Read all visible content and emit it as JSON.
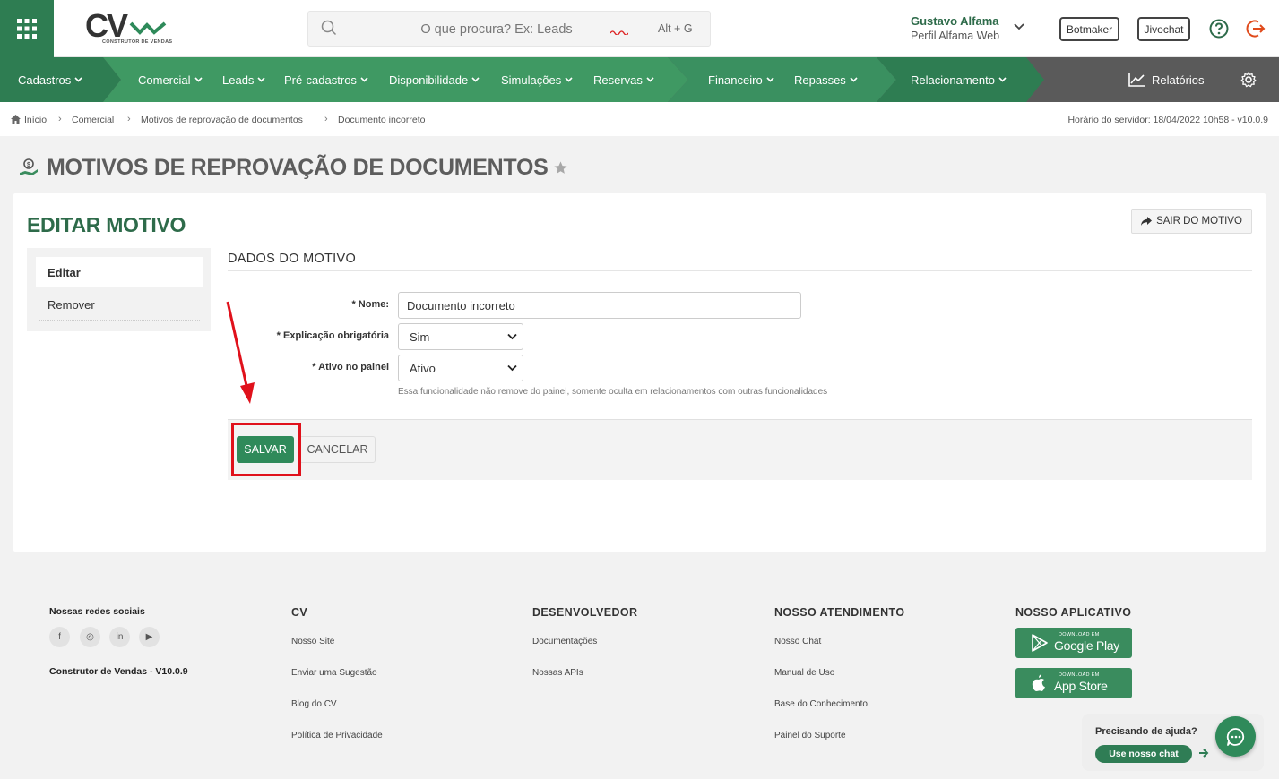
{
  "header": {
    "logo_text": "CV",
    "logo_subtitle": "CONSTRUTOR DE VENDAS",
    "search_placeholder": "O que procura? Ex: Leads",
    "search_shortcut": "Alt + G",
    "user_name": "Gustavo Alfama",
    "user_profile": "Perfil Alfama Web",
    "botmaker_label": "Botmaker",
    "jivochat_label": "Jivochat"
  },
  "nav": {
    "items": [
      {
        "label": "Cadastros"
      },
      {
        "label": "Comercial"
      },
      {
        "label": "Leads"
      },
      {
        "label": "Pré-cadastros"
      },
      {
        "label": "Disponibilidade"
      },
      {
        "label": "Simulações"
      },
      {
        "label": "Reservas"
      },
      {
        "label": "Financeiro"
      },
      {
        "label": "Repasses"
      },
      {
        "label": "Relacionamento"
      }
    ],
    "reports_label": "Relatórios",
    "colors": {
      "dark": "#2e7d52",
      "mid": "#3f9963",
      "light": "#4aa36d",
      "gray": "#5a5a5a"
    }
  },
  "breadcrumb": {
    "items": [
      "Início",
      "Comercial",
      "Motivos de reprovação de documentos",
      "Documento incorreto"
    ],
    "server_time": "Horário do servidor: 18/04/2022 10h58 - v10.0.9"
  },
  "page": {
    "title": "MOTIVOS DE REPROVAÇÃO DE DOCUMENTOS"
  },
  "card": {
    "title": "EDITAR MOTIVO",
    "exit_label": "SAIR DO MOTIVO",
    "side_nav": [
      "Editar",
      "Remover"
    ],
    "section_title": "DADOS DO MOTIVO",
    "fields": {
      "nome_label": "* Nome:",
      "nome_value": "Documento incorreto",
      "explicacao_label": "* Explicação obrigatória",
      "explicacao_value": "Sim",
      "ativo_label": "* Ativo no painel",
      "ativo_value": "Ativo",
      "help_text": "Essa funcionalidade não remove do painel, somente oculta em relacionamentos com outras funcionalidades"
    },
    "save_label": "SALVAR",
    "cancel_label": "CANCELAR"
  },
  "footer": {
    "social_title": "Nossas redes sociais",
    "social_icons": [
      "facebook-icon",
      "instagram-icon",
      "linkedin-icon",
      "youtube-icon"
    ],
    "social_glyphs": [
      "f",
      "◎",
      "in",
      "▶"
    ],
    "version": "Construtor de Vendas - V10.0.9",
    "cols": [
      {
        "title": "CV",
        "links": [
          "Nosso Site",
          "Enviar uma Sugestão",
          "Blog do CV",
          "Política de Privacidade"
        ]
      },
      {
        "title": "DESENVOLVEDOR",
        "links": [
          "Documentações",
          "Nossas APIs"
        ]
      },
      {
        "title": "NOSSO ATENDIMENTO",
        "links": [
          "Nosso Chat",
          "Manual de Uso",
          "Base do Conhecimento",
          "Painel do Suporte"
        ]
      },
      {
        "title": "NOSSO APLICATIVO"
      }
    ],
    "google_small": "DOWNLOAD EM",
    "google_big": "Google Play",
    "apple_small": "DOWNLOAD EM",
    "apple_big": "App Store"
  },
  "help_widget": {
    "title": "Precisando de ajuda?",
    "button": "Use nosso chat"
  },
  "annotation": {
    "highlight_color": "#e0111b"
  }
}
